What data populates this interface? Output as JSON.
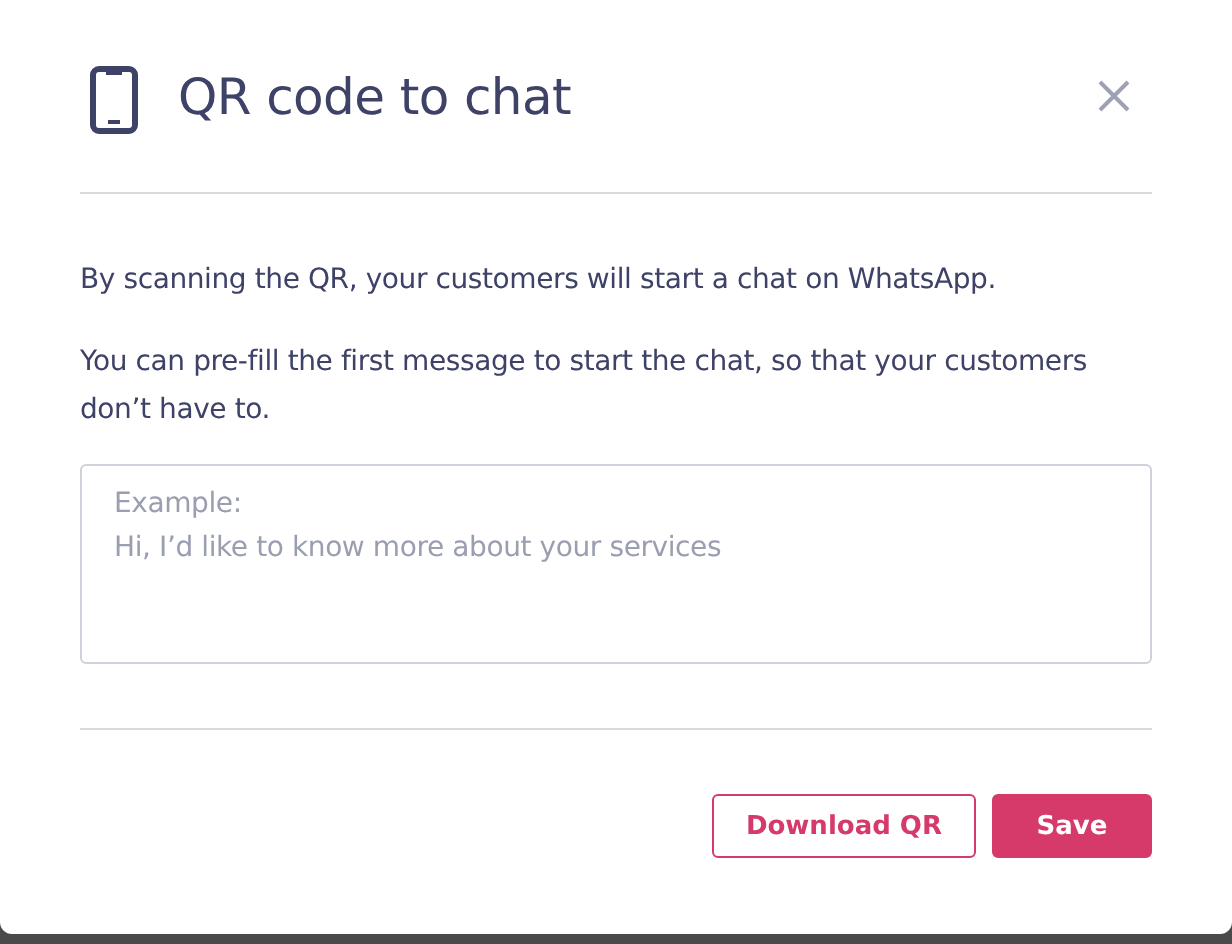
{
  "dialog": {
    "title": "QR code to chat",
    "paragraphs": [
      "By scanning the QR, your customers will start a chat on WhatsApp.",
      "You can pre-fill the first message to start the chat, so that your customers don’t have to."
    ],
    "message_field": {
      "placeholder": "Example:\nHi, I’d like to know more about your services"
    },
    "buttons": [
      {
        "label": "Download QR",
        "kind": "secondary"
      },
      {
        "label": "Save",
        "kind": "primary"
      }
    ]
  }
}
